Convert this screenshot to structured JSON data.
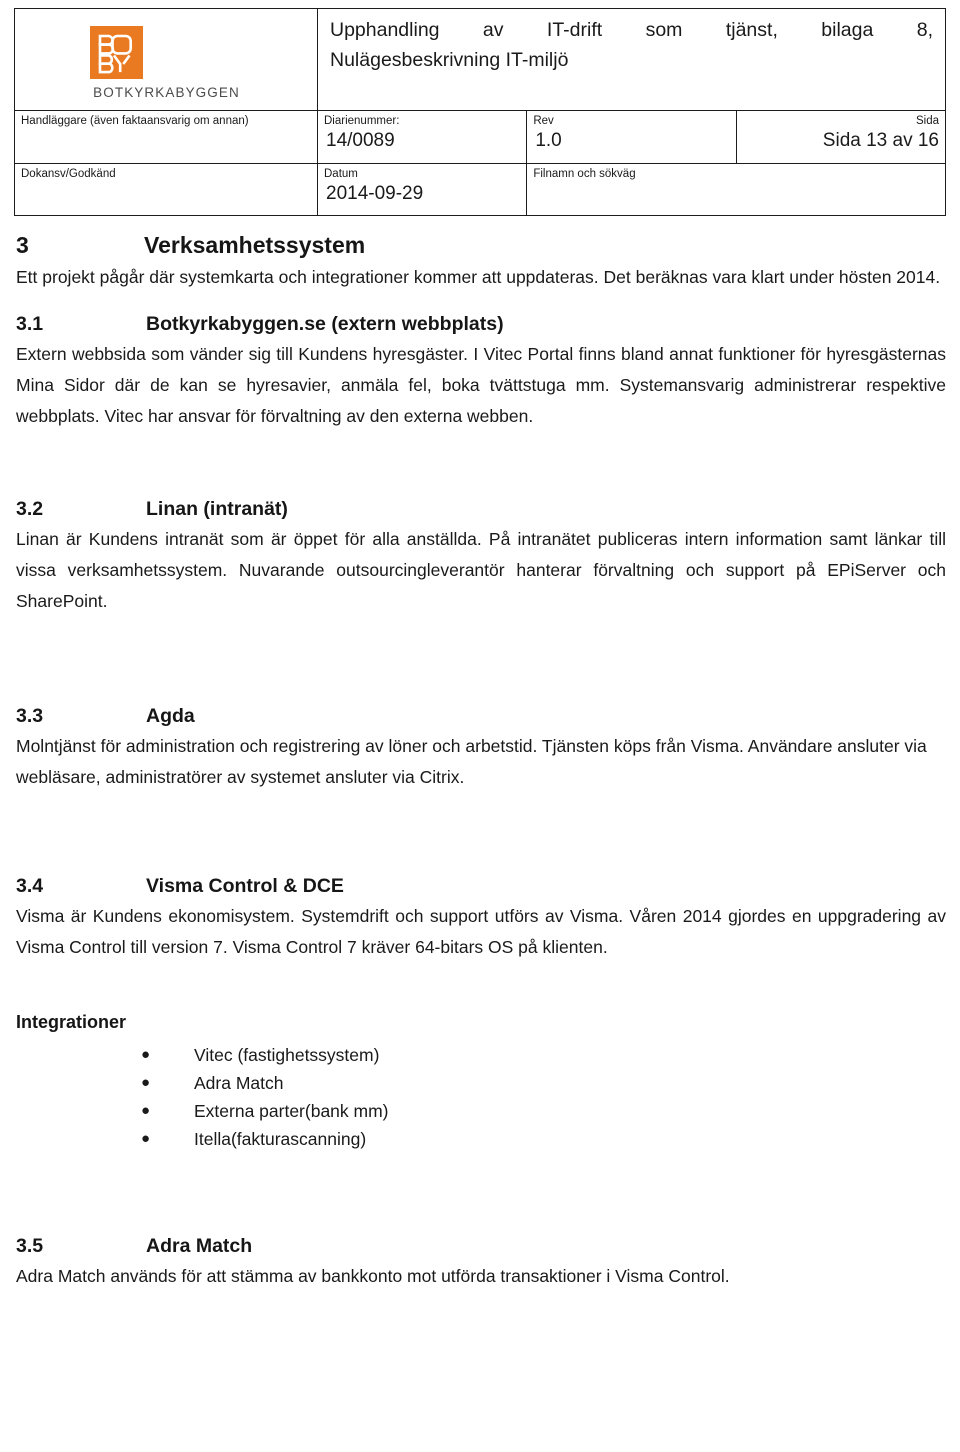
{
  "header": {
    "logo": {
      "mark_text_top": "BO",
      "mark_text_bottom": "BY",
      "wordmark": "BOTKYRKABYGGEN",
      "brand_color": "#ea7a22",
      "wordmark_color": "#4b4b4b"
    },
    "document_title_line1": "Upphandling av IT-drift som tjänst, bilaga 8,",
    "document_title_line2": "Nulägesbeskrivning IT-miljö",
    "fields": {
      "handlaggare_label": "Handläggare (även faktaansvarig om annan)",
      "handlaggare_value": "",
      "diarienummer_label": "Diarienummer:",
      "diarienummer_value": "14/0089",
      "rev_label": "Rev",
      "rev_value": "1.0",
      "sida_label": "Sida",
      "sida_value": "Sida 13 av 16",
      "dokansv_label": "Dokansv/Godkänd",
      "dokansv_value": "",
      "datum_label": "Datum",
      "datum_value": "2014-09-29",
      "filnamn_label": "Filnamn och sökväg",
      "filnamn_value": ""
    }
  },
  "sections": {
    "s3": {
      "number": "3",
      "title": "Verksamhetssystem",
      "body": "Ett projekt pågår där systemkarta och integrationer kommer att uppdateras. Det beräknas vara klart under hösten 2014."
    },
    "s31": {
      "number": "3.1",
      "title": "Botkyrkabyggen.se (extern webbplats)",
      "body": "Extern webbsida som vänder sig till Kundens hyresgäster. I Vitec Portal finns bland annat funktioner för hyresgästernas Mina Sidor där de kan se hyresavier, anmäla fel, boka tvättstuga mm. Systemansvarig administrerar respektive webbplats. Vitec har ansvar för förvaltning av den externa webben."
    },
    "s32": {
      "number": "3.2",
      "title": "Linan (intranät)",
      "body": "Linan är Kundens intranät som är öppet för alla anställda. På intranätet publiceras intern information samt länkar till vissa verksamhetssystem. Nuvarande outsourcingleverantör hanterar förvaltning och support på EPiServer och SharePoint."
    },
    "s33": {
      "number": "3.3",
      "title": "Agda",
      "body": "Molntjänst för administration och registrering av löner och arbetstid. Tjänsten köps från Visma. Användare ansluter via webläsare, administratörer av systemet ansluter via Citrix."
    },
    "s34": {
      "number": "3.4",
      "title": "Visma Control & DCE",
      "body": "Visma är Kundens ekonomisystem. Systemdrift och support utförs av Visma. Våren 2014 gjordes en uppgradering av Visma Control till version 7. Visma Control 7 kräver 64-bitars OS på klienten.",
      "integrations_heading": "Integrationer",
      "integrations": [
        "Vitec (fastighetssystem)",
        "Adra Match",
        "Externa parter(bank mm)",
        "Itella(fakturascanning)"
      ]
    },
    "s35": {
      "number": "3.5",
      "title": "Adra Match",
      "body": "Adra Match används för att stämma av bankkonto mot utförda transaktioner i Visma Control."
    }
  }
}
